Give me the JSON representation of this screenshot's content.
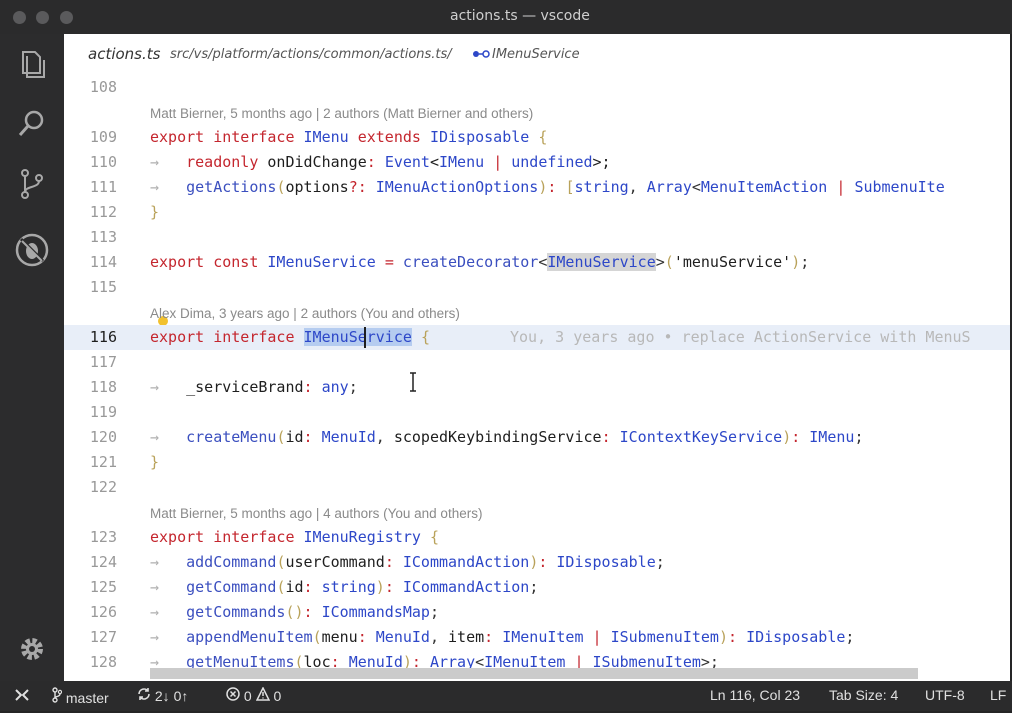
{
  "window": {
    "title": "actions.ts — vscode"
  },
  "activity_bar": {
    "items": [
      "files-icon",
      "search-icon",
      "source-control-icon",
      "debug-icon"
    ],
    "bottom": "settings-gear-icon"
  },
  "breadcrumb": {
    "file": "actions.ts",
    "path": "src/vs/platform/actions/common/actions.ts/",
    "symbol": "IMenuService"
  },
  "code_lenses": {
    "l109": "Matt Bierner, 5 months ago | 2 authors (Matt Bierner and others)",
    "l116": "Alex Dima, 3 years ago | 2 authors (You and others)",
    "l123": "Matt Bierner, 5 months ago | 4 authors (You and others)"
  },
  "line_numbers": {
    "l108": "108",
    "l109": "109",
    "l110": "110",
    "l111": "111",
    "l112": "112",
    "l113": "113",
    "l114": "114",
    "l115": "115",
    "l116": "116",
    "l117": "117",
    "l118": "118",
    "l119": "119",
    "l120": "120",
    "l121": "121",
    "l122": "122",
    "l123": "123",
    "l124": "124",
    "l125": "125",
    "l126": "126",
    "l127": "127",
    "l128": "128"
  },
  "blame_inline": "You, 3 years ago • replace ActionService with MenuS",
  "code_tokens": {
    "export": "export",
    "interface": "interface",
    "const": "const",
    "extends": "extends",
    "readonly": "readonly",
    "arrow": "→",
    "IMenu": "IMenu",
    "IDisposable": "IDisposable",
    "onDidChange": "onDidChange",
    "Event": "Event",
    "undefined": "undefined",
    "getActions": "getActions",
    "options": "options",
    "IMenuActionOptions": "IMenuActionOptions",
    "string": "string",
    "Array": "Array",
    "MenuItemAction": "MenuItemAction",
    "SubmenuIte": "SubmenuIte",
    "IMenuService": "IMenuService",
    "createDecorator": "createDecorator",
    "menuServiceStr": "'menuService'",
    "IMenu_sel": "IMenu",
    "Service_sel": "Service",
    "serviceBrand": "_serviceBrand",
    "any": "any",
    "createMenu": "createMenu",
    "id": "id",
    "MenuId": "MenuId",
    "scopedKeybindingService": "scopedKeybindingService",
    "IContextKeyService": "IContextKeyService",
    "IMenuRegistry": "IMenuRegistry",
    "addCommand": "addCommand",
    "userCommand": "userCommand",
    "ICommandAction": "ICommandAction",
    "getCommand": "getCommand",
    "getCommands": "getCommands",
    "ICommandsMap": "ICommandsMap",
    "appendMenuItem": "appendMenuItem",
    "menu": "menu",
    "item": "item",
    "IMenuItem": "IMenuItem",
    "ISubmenuItem": "ISubmenuItem",
    "getMenuItems": "getMenuItems",
    "loc": "loc"
  },
  "status_bar": {
    "branch": "master",
    "sync": "2↓ 0↑",
    "problems": "0",
    "warnings": "0",
    "cursor_pos": "Ln 116, Col 23",
    "tab_size": "Tab Size: 4",
    "encoding": "UTF-8",
    "eol": "LF"
  },
  "colors": {
    "keyword": "#c4262e",
    "type": "#2d47c8",
    "selection": "#b5ccf0"
  }
}
